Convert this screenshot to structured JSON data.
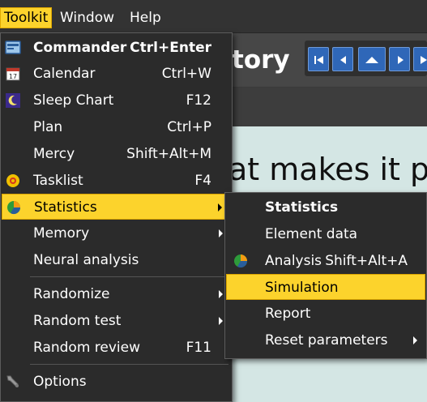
{
  "menubar": {
    "items": [
      {
        "label": "Toolkit",
        "active": true
      },
      {
        "label": "Window",
        "active": false
      },
      {
        "label": "Help",
        "active": false
      }
    ]
  },
  "background": {
    "window_title_fragment": "tory",
    "content_text_fragment": "at makes it p",
    "nav_buttons": [
      "first-icon",
      "prev-icon",
      "up-icon",
      "next-icon",
      "last-icon"
    ],
    "content_color": "#d4e6e4"
  },
  "toolkit_menu": {
    "items": [
      {
        "label": "Commander",
        "shortcut": "Ctrl+Enter",
        "icon": "commander-icon",
        "bold": true
      },
      {
        "label": "Calendar",
        "shortcut": "Ctrl+W",
        "icon": "calendar-icon"
      },
      {
        "label": "Sleep Chart",
        "shortcut": "F12",
        "icon": "sleep-chart-icon"
      },
      {
        "label": "Plan",
        "shortcut": "Ctrl+P"
      },
      {
        "label": "Mercy",
        "shortcut": "Shift+Alt+M"
      },
      {
        "label": "Tasklist",
        "shortcut": "F4",
        "icon": "tasklist-icon"
      },
      {
        "label": "Statistics",
        "submenu": true,
        "highlighted": true,
        "icon": "statistics-icon"
      },
      {
        "label": "Memory",
        "submenu": true
      },
      {
        "label": "Neural analysis"
      },
      {
        "label": "Randomize",
        "submenu": true
      },
      {
        "label": "Random test",
        "submenu": true
      },
      {
        "label": "Random review",
        "shortcut": "F11"
      },
      {
        "label": "Options",
        "icon": "wrench-icon"
      }
    ]
  },
  "statistics_submenu": {
    "items": [
      {
        "label": "Statistics",
        "bold": true
      },
      {
        "label": "Element data"
      },
      {
        "label": "Analysis",
        "shortcut": "Shift+Alt+A",
        "icon": "analysis-icon"
      },
      {
        "label": "Simulation",
        "highlighted": true
      },
      {
        "label": "Report"
      },
      {
        "label": "Reset parameters",
        "submenu": true
      }
    ]
  },
  "colors": {
    "highlight": "#fcd32c",
    "menu_bg": "#2b2b2b",
    "nav_button": "#2f67b8"
  }
}
